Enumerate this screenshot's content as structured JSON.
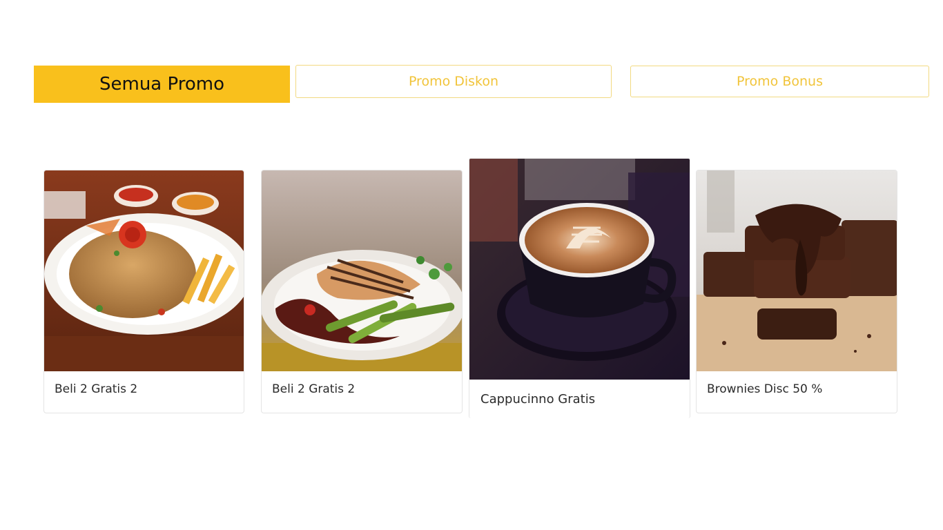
{
  "tabs": [
    {
      "label": "Semua Promo",
      "active": true
    },
    {
      "label": "Promo Diskon",
      "active": false
    },
    {
      "label": "Promo Bonus",
      "active": false
    }
  ],
  "promos": [
    {
      "title": "Beli 2 Gratis 2",
      "image": "fried-rice-with-fries"
    },
    {
      "title": "Beli 2 Gratis 2",
      "image": "grilled-chicken-with-asparagus"
    },
    {
      "title": "Cappucinno Gratis",
      "image": "cappuccino-latte-art"
    },
    {
      "title": "Brownies Disc 50 %",
      "image": "chocolate-brownies"
    }
  ],
  "colors": {
    "accent": "#f9c01c",
    "tab_outline_text": "#f1c43a",
    "tab_outline_border": "#f2d980"
  }
}
